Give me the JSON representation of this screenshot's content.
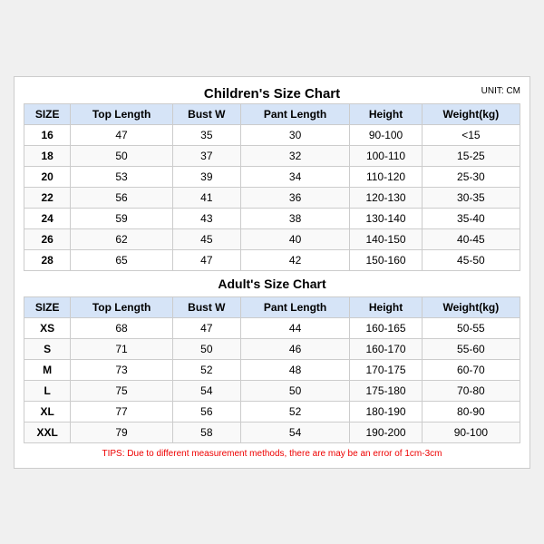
{
  "chart": {
    "mainTitle": "Children's Size Chart",
    "unitLabel": "UNIT: CM",
    "adultTitle": "Adult's Size Chart",
    "headers": [
      "SIZE",
      "Top Length",
      "Bust W",
      "Pant Length",
      "Height",
      "Weight(kg)"
    ],
    "childrenRows": [
      [
        "16",
        "47",
        "35",
        "30",
        "90-100",
        "<15"
      ],
      [
        "18",
        "50",
        "37",
        "32",
        "100-110",
        "15-25"
      ],
      [
        "20",
        "53",
        "39",
        "34",
        "110-120",
        "25-30"
      ],
      [
        "22",
        "56",
        "41",
        "36",
        "120-130",
        "30-35"
      ],
      [
        "24",
        "59",
        "43",
        "38",
        "130-140",
        "35-40"
      ],
      [
        "26",
        "62",
        "45",
        "40",
        "140-150",
        "40-45"
      ],
      [
        "28",
        "65",
        "47",
        "42",
        "150-160",
        "45-50"
      ]
    ],
    "adultRows": [
      [
        "XS",
        "68",
        "47",
        "44",
        "160-165",
        "50-55"
      ],
      [
        "S",
        "71",
        "50",
        "46",
        "160-170",
        "55-60"
      ],
      [
        "M",
        "73",
        "52",
        "48",
        "170-175",
        "60-70"
      ],
      [
        "L",
        "75",
        "54",
        "50",
        "175-180",
        "70-80"
      ],
      [
        "XL",
        "77",
        "56",
        "52",
        "180-190",
        "80-90"
      ],
      [
        "XXL",
        "79",
        "58",
        "54",
        "190-200",
        "90-100"
      ]
    ],
    "tips": "TIPS: Due to different measurement methods, there are may be an error of 1cm-3cm"
  }
}
